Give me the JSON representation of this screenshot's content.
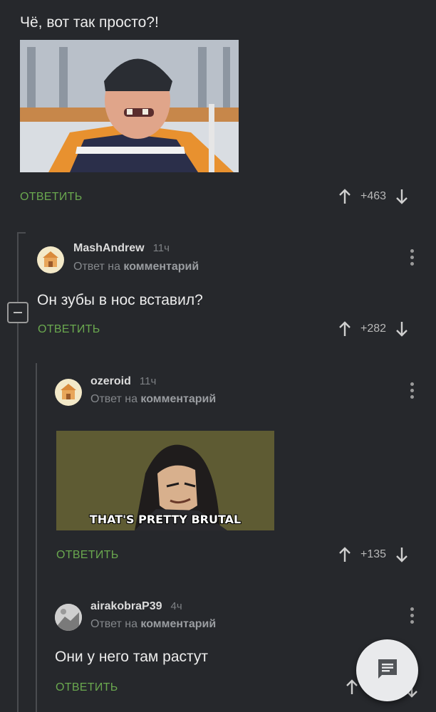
{
  "post_comment": {
    "text": "Чё, вот так просто?!",
    "reply_label": "ОТВЕТИТЬ",
    "score": "+463"
  },
  "comment1": {
    "author": "MashAndrew",
    "time": "11ч",
    "reply_prefix": "Ответ на",
    "reply_target": "комментарий",
    "text": "Он зубы в нос вставил?",
    "reply_label": "ОТВЕТИТЬ",
    "score": "+282"
  },
  "comment2": {
    "author": "ozeroid",
    "time": "11ч",
    "reply_prefix": "Ответ на",
    "reply_target": "комментарий",
    "image_caption": "THAT'S PRETTY BRUTAL",
    "reply_label": "ОТВЕТИТЬ",
    "score": "+135"
  },
  "comment3": {
    "author": "airakobraP39",
    "time": "4ч",
    "reply_prefix": "Ответ на",
    "reply_target": "комментарий",
    "text": "Они у него там растут",
    "reply_label": "ОТВЕТИТЬ"
  },
  "icons": {
    "upvote": "arrow-up-icon",
    "downvote": "arrow-down-icon",
    "more": "more-vertical-icon",
    "collapse": "minus-icon",
    "fab": "message-icon"
  },
  "colors": {
    "background": "#26282c",
    "accent_green": "#6aa84f",
    "fab": "#e9eaec"
  }
}
